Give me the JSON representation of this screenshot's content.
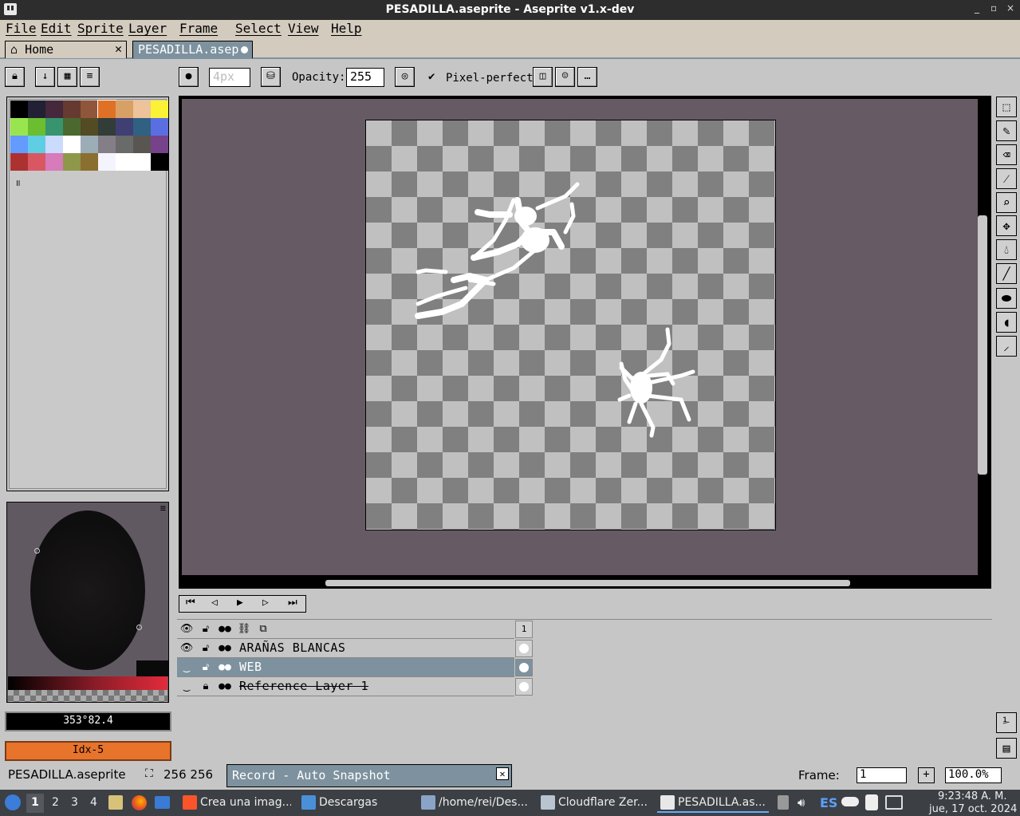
{
  "window": {
    "title": "PESADILLA.aseprite - Aseprite v1.x-dev",
    "minimize": "_",
    "maximize": "▫",
    "close": "×"
  },
  "menu": [
    "File",
    "Edit",
    "Sprite",
    "Layer",
    "Frame",
    "Select",
    "View",
    "Help"
  ],
  "tabs": {
    "home": "Home",
    "active": "PESADILLA.asep"
  },
  "toolbar": {
    "brush_size": "4px",
    "opacity_label": "Opacity:",
    "opacity_value": "255",
    "pixel_perfect": "Pixel-perfect"
  },
  "palette": {
    "colors": [
      "#000000",
      "#222034",
      "#45283c",
      "#663931",
      "#8f563b",
      "#df7126",
      "#d9a066",
      "#eec39a",
      "#fbf236",
      "#99e550",
      "#6abe30",
      "#37946e",
      "#4b692f",
      "#524b24",
      "#323c39",
      "#3f3f74",
      "#306082",
      "#5b6ee1",
      "#639bff",
      "#5fcde4",
      "#cbdbfc",
      "#ffffff",
      "#9badb7",
      "#847e87",
      "#696a6a",
      "#595652",
      "#76428a",
      "#ac3232",
      "#d95763",
      "#d77bba",
      "#8f974a",
      "#8a6f30",
      "#f4f4ff",
      "#ffffff",
      "#ffffff",
      "#000000"
    ]
  },
  "color_readout": "353°82.4",
  "color_index": "Idx-5",
  "colors": {
    "accent": "#e8732b",
    "selection": "#7d929e",
    "canvas_bg": "#665a64"
  },
  "layers": [
    {
      "name": "ARAÑAS BLANCAS",
      "visible": true,
      "locked": false,
      "active": false
    },
    {
      "name": "WEB",
      "visible": false,
      "locked": false,
      "active": true
    },
    {
      "name": "Reference Layer 1",
      "visible": false,
      "locked": true,
      "active": false,
      "reference": true
    }
  ],
  "timeline": {
    "frame_header": "1"
  },
  "status": {
    "file": "PESADILLA.aseprite",
    "size": "256 256",
    "record": "Record - Auto Snapshot",
    "frame_label": "Frame:",
    "frame_value": "1",
    "zoom": "100.0%"
  },
  "taskbar": {
    "workspaces": [
      "1",
      "2",
      "3",
      "4"
    ],
    "tasks": [
      "Crea una imag...",
      "Descargas",
      "/home/rei/Des...",
      "Cloudflare Zer...",
      "PESADILLA.as..."
    ],
    "lang": "ES",
    "time": "9:23:48 A. M.",
    "date": "jue, 17 oct. 2024"
  }
}
